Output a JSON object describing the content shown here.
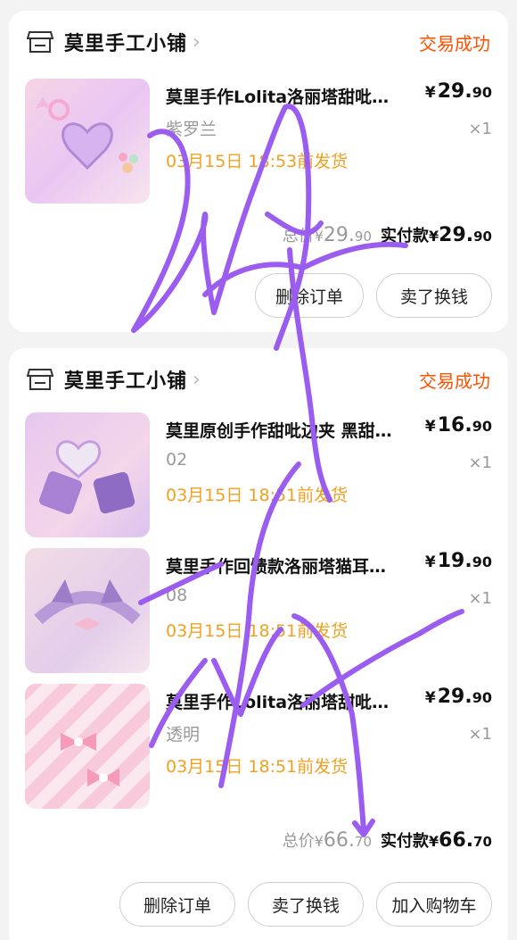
{
  "orders": [
    {
      "shop_name": "莫里手工小铺",
      "status": "交易成功",
      "items": [
        {
          "title": "莫里手作Lolita洛丽塔甜吡…",
          "price_int": "29.",
          "price_dec": "90",
          "sku": "紫罗兰",
          "qty": "×1",
          "ship": "03月15日 18:53前发货"
        }
      ],
      "total_label": "总价",
      "total_int": "29.",
      "total_dec": "90",
      "pay_label": "实付款",
      "pay_int": "29.",
      "pay_dec": "90",
      "buttons": [
        "删除订单",
        "卖了换钱"
      ]
    },
    {
      "shop_name": "莫里手工小铺",
      "status": "交易成功",
      "items": [
        {
          "title": "莫里原创手作甜吡边夹 黑甜…",
          "price_int": "16.",
          "price_dec": "90",
          "sku": "02",
          "qty": "×1",
          "ship": "03月15日 18:51前发货"
        },
        {
          "title": "莫里手作回馈款洛丽塔猫耳…",
          "price_int": "19.",
          "price_dec": "90",
          "sku": "08",
          "qty": "×1",
          "ship": "03月15日 18:51前发货"
        },
        {
          "title": "莫里手作Lolita洛丽塔甜吡…",
          "price_int": "29.",
          "price_dec": "90",
          "sku": "透明",
          "qty": "×1",
          "ship": "03月15日 18:51前发货"
        }
      ],
      "total_label": "总价",
      "total_int": "66.",
      "total_dec": "70",
      "pay_label": "实付款",
      "pay_int": "66.",
      "pay_dec": "70",
      "buttons": [
        "删除订单",
        "卖了换钱",
        "加入购物车"
      ]
    }
  ],
  "currency": "¥",
  "colors": {
    "accent": "#ff5000",
    "ship": "#f0a020",
    "scribble": "#9b5cf0"
  },
  "icons": {
    "shop": "store-icon",
    "chevron": "chevron-right-icon"
  }
}
